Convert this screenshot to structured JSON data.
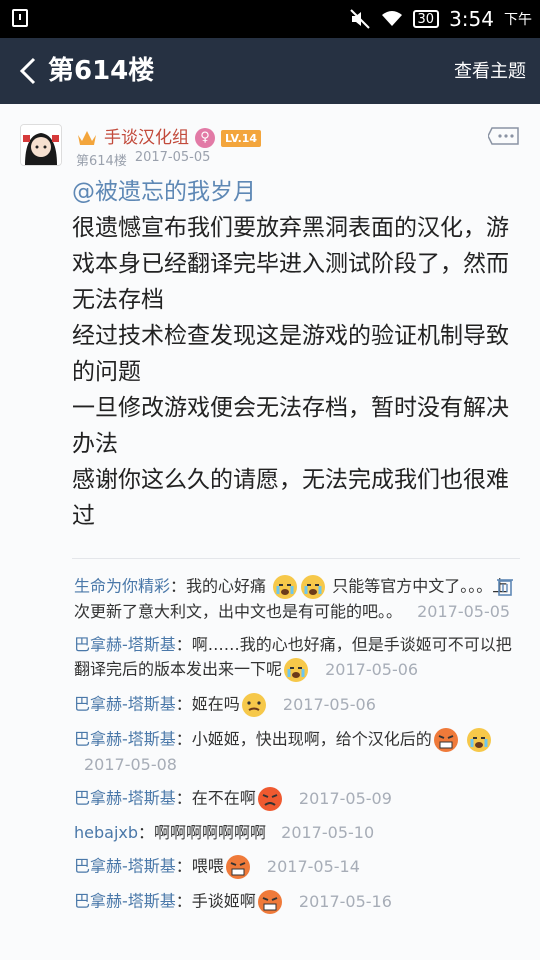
{
  "status_bar": {
    "time": "3:54",
    "ampm": "下午",
    "battery": "30"
  },
  "nav": {
    "title": "第614楼",
    "right_action": "查看主题"
  },
  "post": {
    "username": "手谈汉化组",
    "level": "LV.14",
    "floor": "第614楼",
    "date": "2017-05-05",
    "mention": "@被遗忘的我岁月",
    "lines": [
      "很遗憾宣布我们要放弃黑洞表面的汉化，游戏本身已经翻译完毕进入测试阶段了，然而无法存档",
      "经过技术检查发现这是游戏的验证机制导致的问题",
      "一旦修改游戏便会无法存档，暂时没有解决办法",
      "感谢你这么久的请愿，无法完成我们也很难过"
    ]
  },
  "replies": [
    {
      "name": "生命为你精彩",
      "text_a": "我的心好痛",
      "text_b": "只能等官方中文了。。。上次更新了意大利文，出中文也是有可能的吧。。",
      "date": "2017-05-05"
    },
    {
      "name": "巴拿赫-塔斯基",
      "text_a": "啊……我的心也好痛，但是手谈姬可不可以把翻译完后的版本发出来一下呢",
      "date": "2017-05-06"
    },
    {
      "name": "巴拿赫-塔斯基",
      "text_a": "姬在吗",
      "date": "2017-05-06"
    },
    {
      "name": "巴拿赫-塔斯基",
      "text_a": "小姬姬，快出现啊，给个汉化后的",
      "date": "2017-05-08"
    },
    {
      "name": "巴拿赫-塔斯基",
      "text_a": "在不在啊",
      "date": "2017-05-09"
    },
    {
      "name": "hebajxb",
      "text_a": "啊啊啊啊啊啊啊",
      "date": "2017-05-10"
    },
    {
      "name": "巴拿赫-塔斯基",
      "text_a": "喂喂",
      "date": "2017-05-14"
    },
    {
      "name": "巴拿赫-塔斯基",
      "text_a": "手谈姬啊",
      "date": "2017-05-16"
    }
  ],
  "colors": {
    "nav_bg": "#263142",
    "name_blue": "#4a78a9",
    "username_red": "#c24a3b",
    "level_orange": "#f3a53c"
  },
  "icons": [
    "back-chevron-icon",
    "crown-icon",
    "female-icon",
    "more-icon",
    "trash-icon",
    "crying-emoji-icon",
    "angry-emoji-icon",
    "wifi-icon",
    "mute-icon"
  ]
}
